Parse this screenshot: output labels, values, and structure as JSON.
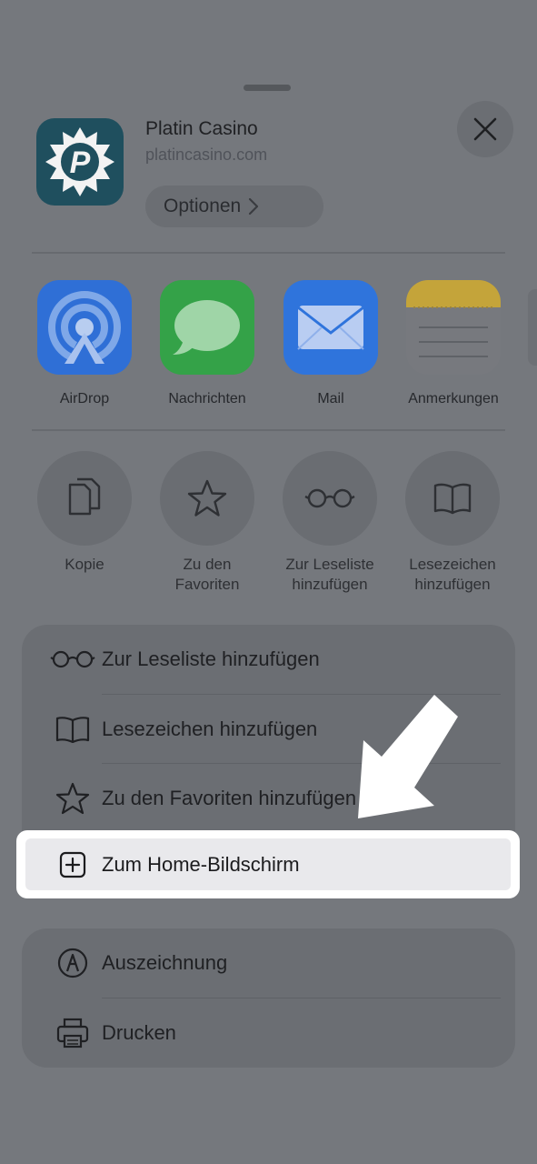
{
  "header": {
    "app_title": "Platin Casino",
    "app_url": "platincasino.com",
    "options_label": "Optionen",
    "app_logo_letter": "P"
  },
  "share_row": [
    {
      "label": "AirDrop",
      "icon": "airdrop-icon"
    },
    {
      "label": "Nachrichten",
      "icon": "messages-icon"
    },
    {
      "label": "Mail",
      "icon": "mail-icon"
    },
    {
      "label": "Anmerkungen",
      "icon": "notes-icon"
    }
  ],
  "action_row": [
    {
      "line1": "Kopie",
      "line2": "",
      "icon": "copy-icon"
    },
    {
      "line1": "Zu den",
      "line2": "Favoriten",
      "icon": "star-icon"
    },
    {
      "line1": "Zur Leseliste",
      "line2": "hinzufügen",
      "icon": "glasses-icon"
    },
    {
      "line1": "Lesezeichen",
      "line2": "hinzufügen",
      "icon": "book-icon"
    }
  ],
  "list1": [
    {
      "label": "Zur Leseliste hinzufügen",
      "icon": "glasses-icon"
    },
    {
      "label": "Lesezeichen hinzufügen",
      "icon": "book-icon"
    },
    {
      "label": "Zu den Favoriten hinzufügen",
      "icon": "star-icon"
    },
    {
      "label": "Zum Home-Bildschirm",
      "icon": "add-square-icon"
    }
  ],
  "list2": [
    {
      "label": "Auszeichnung",
      "icon": "markup-icon"
    },
    {
      "label": "Drucken",
      "icon": "printer-icon"
    }
  ],
  "colors": {
    "overlay": "#75787d",
    "highlight_border": "#ffffff",
    "arrow": "#ffffff",
    "airdrop": "#2f6fd6",
    "messages": "#34b04a",
    "mail": "#2f74dc",
    "notes_top": "#e0bb2e",
    "app_bg": "#1f4f5e"
  }
}
